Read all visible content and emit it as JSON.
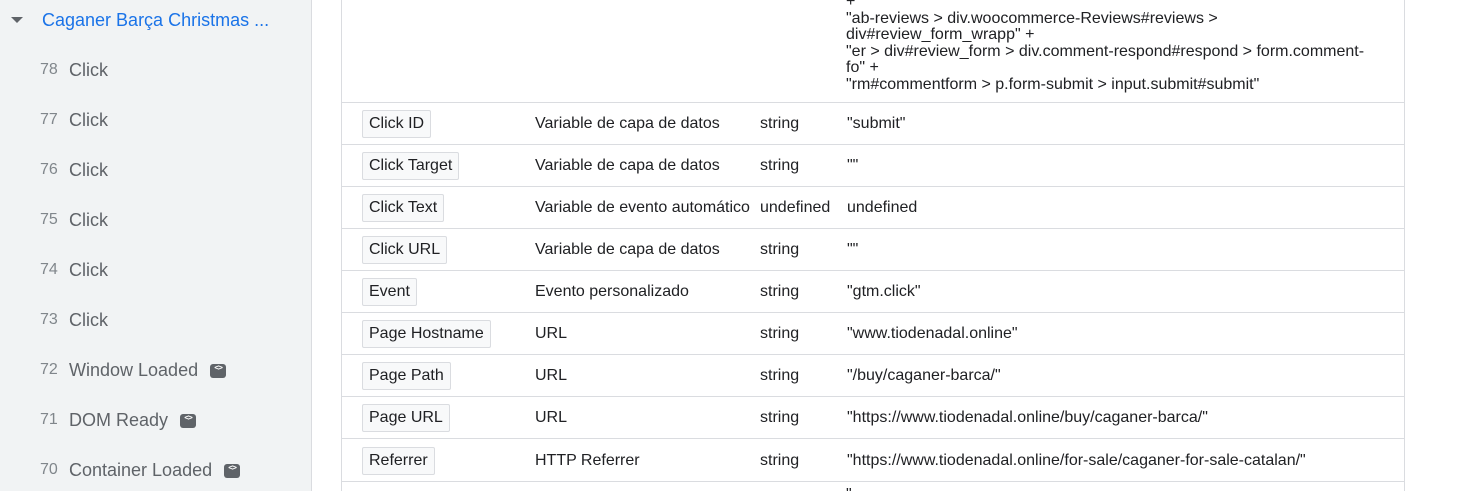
{
  "sidebar": {
    "title": "Caganer Barça Christmas ...",
    "items": [
      {
        "num": "78",
        "label": "Click",
        "badge": false
      },
      {
        "num": "77",
        "label": "Click",
        "badge": false
      },
      {
        "num": "76",
        "label": "Click",
        "badge": false
      },
      {
        "num": "75",
        "label": "Click",
        "badge": false
      },
      {
        "num": "74",
        "label": "Click",
        "badge": false
      },
      {
        "num": "73",
        "label": "Click",
        "badge": false
      },
      {
        "num": "72",
        "label": "Window Loaded",
        "badge": true
      },
      {
        "num": "71",
        "label": "DOM Ready",
        "badge": true
      },
      {
        "num": "70",
        "label": "Container Loaded",
        "badge": true
      }
    ]
  },
  "table": {
    "top_value_lines": [
      "+",
      "\"ab-reviews > div.woocommerce-Reviews#reviews >",
      "div#review_form_wrapp\" +",
      "\"er > div#review_form > div.comment-respond#respond > form.comment-",
      "fo\" +",
      "\"rm#commentform > p.form-submit > input.submit#submit\""
    ],
    "rows": [
      {
        "name": "Click ID",
        "type": "Variable de capa de datos",
        "return_type": "string",
        "value": "\"submit\""
      },
      {
        "name": "Click Target",
        "type": "Variable de capa de datos",
        "return_type": "string",
        "value": "\"\""
      },
      {
        "name": "Click Text",
        "type": "Variable de evento automático",
        "return_type": "undefined",
        "value": "undefined"
      },
      {
        "name": "Click URL",
        "type": "Variable de capa de datos",
        "return_type": "string",
        "value": "\"\""
      },
      {
        "name": "Event",
        "type": "Evento personalizado",
        "return_type": "string",
        "value": "\"gtm.click\""
      },
      {
        "name": "Page Hostname",
        "type": "URL",
        "return_type": "string",
        "value": "\"www.tiodenadal.online\""
      },
      {
        "name": "Page Path",
        "type": "URL",
        "return_type": "string",
        "value": "\"/buy/caganer-barca/\""
      },
      {
        "name": "Page URL",
        "type": "URL",
        "return_type": "string",
        "value": "\"https://www.tiodenadal.online/buy/caganer-barca/\""
      },
      {
        "name": "Referrer",
        "type": "HTTP Referrer",
        "return_type": "string",
        "value": "\"https://www.tiodenadal.online/for-sale/caganer-for-sale-catalan/\""
      }
    ],
    "partial_next_value": "\""
  }
}
